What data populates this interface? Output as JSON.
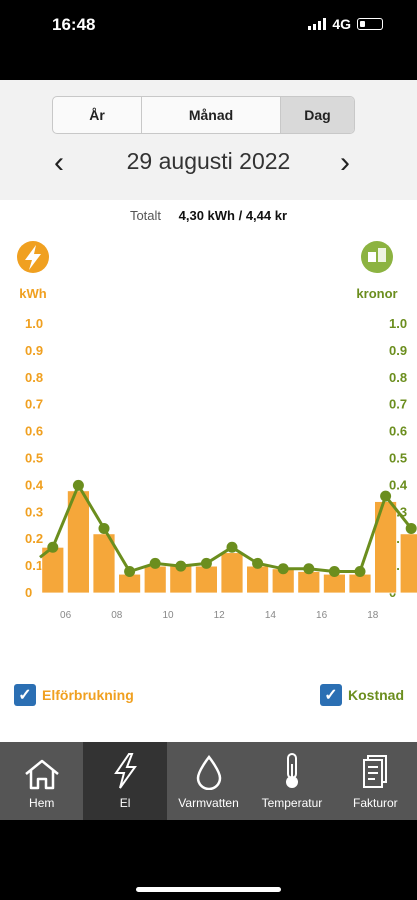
{
  "status": {
    "time": "16:48",
    "network": "4G"
  },
  "tabs": [
    {
      "label": "År",
      "selected": false
    },
    {
      "label": "Månad",
      "selected": false
    },
    {
      "label": "Dag",
      "selected": true
    }
  ],
  "date": {
    "prev": "‹",
    "label": "29 augusti 2022",
    "next": "›"
  },
  "total": {
    "label": "Totalt",
    "value": "4,30 kWh / 4,44 kr"
  },
  "colors": {
    "energy": "#f0a020",
    "cost": "#6b8e1e",
    "checkbox": "#2b6fb3",
    "nav_bg": "#555555",
    "nav_active": "#333333"
  },
  "chart_data": {
    "type": "bar",
    "left_axis": {
      "unit": "kWh",
      "ticks": [
        "0",
        "0.1",
        "0.2",
        "0.3",
        "0.4",
        "0.5",
        "0.6",
        "0.7",
        "0.8",
        "0.9",
        "1.0"
      ],
      "ylim": [
        0,
        1.0
      ]
    },
    "right_axis": {
      "unit": "kronor",
      "ticks": [
        "0",
        "0.1",
        "0.2",
        "0.3",
        "0.4",
        "0.5",
        "0.6",
        "0.7",
        "0.8",
        "0.9",
        "1.0"
      ],
      "ylim": [
        0,
        1.0
      ]
    },
    "x_ticks": [
      "06",
      "08",
      "10",
      "12",
      "14",
      "16",
      "18"
    ],
    "hours": [
      5,
      6,
      7,
      8,
      9,
      10,
      11,
      12,
      13,
      14,
      15,
      16,
      17,
      18,
      19
    ],
    "series": [
      {
        "name": "Elförbrukning",
        "type": "bar",
        "values": [
          0.17,
          0.38,
          0.22,
          0.07,
          0.1,
          0.1,
          0.1,
          0.15,
          0.1,
          0.09,
          0.08,
          0.07,
          0.07,
          0.34,
          0.22
        ]
      },
      {
        "name": "Kostnad",
        "type": "line",
        "values": [
          0.17,
          0.4,
          0.24,
          0.08,
          0.11,
          0.1,
          0.11,
          0.17,
          0.11,
          0.09,
          0.09,
          0.08,
          0.08,
          0.36,
          0.24
        ]
      }
    ]
  },
  "legend": {
    "left": "Elförbrukning",
    "right": "Kostnad",
    "check": "✓"
  },
  "nav": [
    {
      "label": "Hem",
      "icon": "house-icon",
      "active": false
    },
    {
      "label": "El",
      "icon": "lightning-icon",
      "active": true
    },
    {
      "label": "Varmvatten",
      "icon": "water-drop-icon",
      "active": false
    },
    {
      "label": "Temperatur",
      "icon": "thermometer-icon",
      "active": false
    },
    {
      "label": "Fakturor",
      "icon": "invoice-icon",
      "active": false
    }
  ]
}
